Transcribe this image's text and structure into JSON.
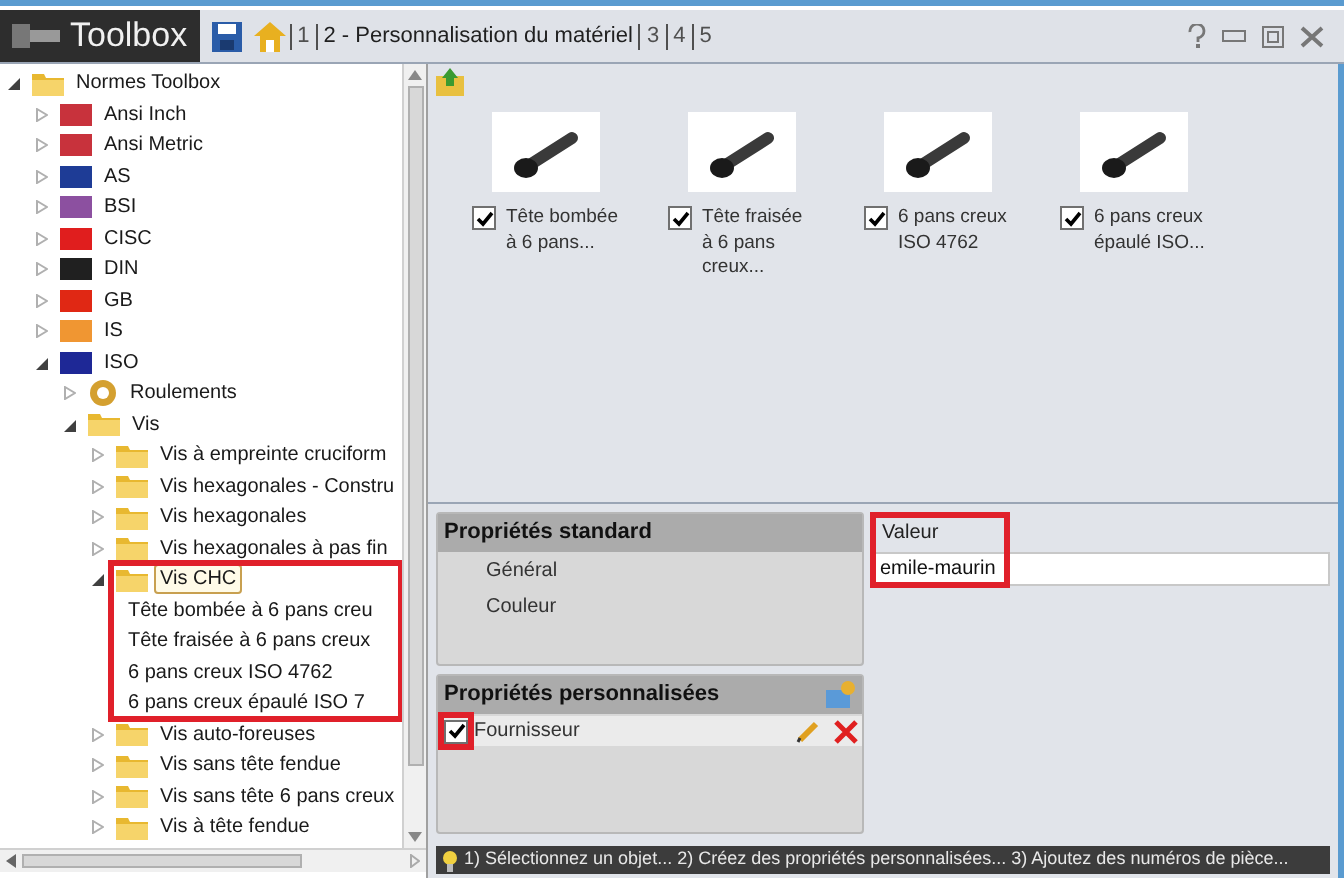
{
  "title_bar": {
    "app_name": "Toolbox",
    "tabs": [
      {
        "label": "1",
        "selected": false
      },
      {
        "label": "2 - Personnalisation du matériel",
        "selected": true
      },
      {
        "label": "3",
        "selected": false
      },
      {
        "label": "4",
        "selected": false
      },
      {
        "label": "5",
        "selected": false
      }
    ]
  },
  "tree": [
    {
      "label": "Normes Toolbox",
      "kind": "folder",
      "expanded": true,
      "selected": false,
      "children": [
        {
          "label": "Ansi Inch",
          "kind": "flag",
          "color": "#c8323c",
          "expanded": false,
          "selected": false
        },
        {
          "label": "Ansi Metric",
          "kind": "flag",
          "color": "#c8323c",
          "expanded": false,
          "selected": false
        },
        {
          "label": "AS",
          "kind": "flag",
          "color": "#1e3c96",
          "expanded": false,
          "selected": false
        },
        {
          "label": "BSI",
          "kind": "flag",
          "color": "#8c50a0",
          "expanded": false,
          "selected": false
        },
        {
          "label": "CISC",
          "kind": "flag",
          "color": "#e01e1e",
          "expanded": false,
          "selected": false
        },
        {
          "label": "DIN",
          "kind": "flag",
          "color": "#202020",
          "expanded": false,
          "selected": false
        },
        {
          "label": "GB",
          "kind": "flag",
          "color": "#e02814",
          "expanded": false,
          "selected": false
        },
        {
          "label": "IS",
          "kind": "flag",
          "color": "#f09632",
          "expanded": false,
          "selected": false
        },
        {
          "label": "ISO",
          "kind": "flag",
          "color": "#1e2896",
          "expanded": true,
          "selected": false,
          "children": [
            {
              "label": "Roulements",
              "kind": "bearing",
              "expanded": false,
              "selected": false
            },
            {
              "label": "Vis",
              "kind": "folder",
              "expanded": true,
              "selected": false,
              "children": [
                {
                  "label": "Vis à empreinte cruciform",
                  "kind": "folder",
                  "expanded": false,
                  "selected": false
                },
                {
                  "label": "Vis hexagonales - Constru",
                  "kind": "folder",
                  "expanded": false,
                  "selected": false
                },
                {
                  "label": "Vis hexagonales",
                  "kind": "folder",
                  "expanded": false,
                  "selected": false
                },
                {
                  "label": "Vis hexagonales à pas fin",
                  "kind": "folder",
                  "expanded": false,
                  "selected": false
                },
                {
                  "label": "Vis CHC",
                  "kind": "folder",
                  "expanded": true,
                  "selected": true,
                  "children": [
                    {
                      "label": "Tête bombée à 6 pans creu",
                      "kind": "leaf",
                      "selected": false
                    },
                    {
                      "label": "Tête fraisée à 6 pans creux",
                      "kind": "leaf",
                      "selected": false
                    },
                    {
                      "label": "6 pans creux ISO 4762",
                      "kind": "leaf",
                      "selected": false
                    },
                    {
                      "label": "6 pans creux épaulé ISO 7",
                      "kind": "leaf",
                      "selected": false
                    }
                  ]
                },
                {
                  "label": "Vis auto-foreuses",
                  "kind": "folder",
                  "expanded": false,
                  "selected": false
                },
                {
                  "label": "Vis sans tête fendue",
                  "kind": "folder",
                  "expanded": false,
                  "selected": false
                },
                {
                  "label": "Vis sans tête 6 pans creux",
                  "kind": "folder",
                  "expanded": false,
                  "selected": false
                },
                {
                  "label": "Vis à tête fendue",
                  "kind": "folder",
                  "expanded": false,
                  "selected": false
                }
              ]
            }
          ]
        }
      ]
    }
  ],
  "parts": [
    {
      "caption": "Tête bombée à 6 pans...",
      "checked": true
    },
    {
      "caption": "Tête fraisée à 6 pans creux...",
      "checked": true
    },
    {
      "caption": "6 pans creux ISO 4762",
      "checked": true
    },
    {
      "caption": "6 pans creux épaulé ISO...",
      "checked": true
    }
  ],
  "standard_properties": {
    "title": "Propriétés standard",
    "items": [
      "Général",
      "Couleur"
    ]
  },
  "value": {
    "label": "Valeur",
    "value": "emile-maurin"
  },
  "custom_properties": {
    "title": "Propriétés personnalisées",
    "items": [
      {
        "label": "Fournisseur",
        "checked": true
      }
    ]
  },
  "status_bar": {
    "text": "1) Sélectionnez un objet... 2) Créez des propriétés personnalisées... 3) Ajoutez des numéros de pièce..."
  }
}
